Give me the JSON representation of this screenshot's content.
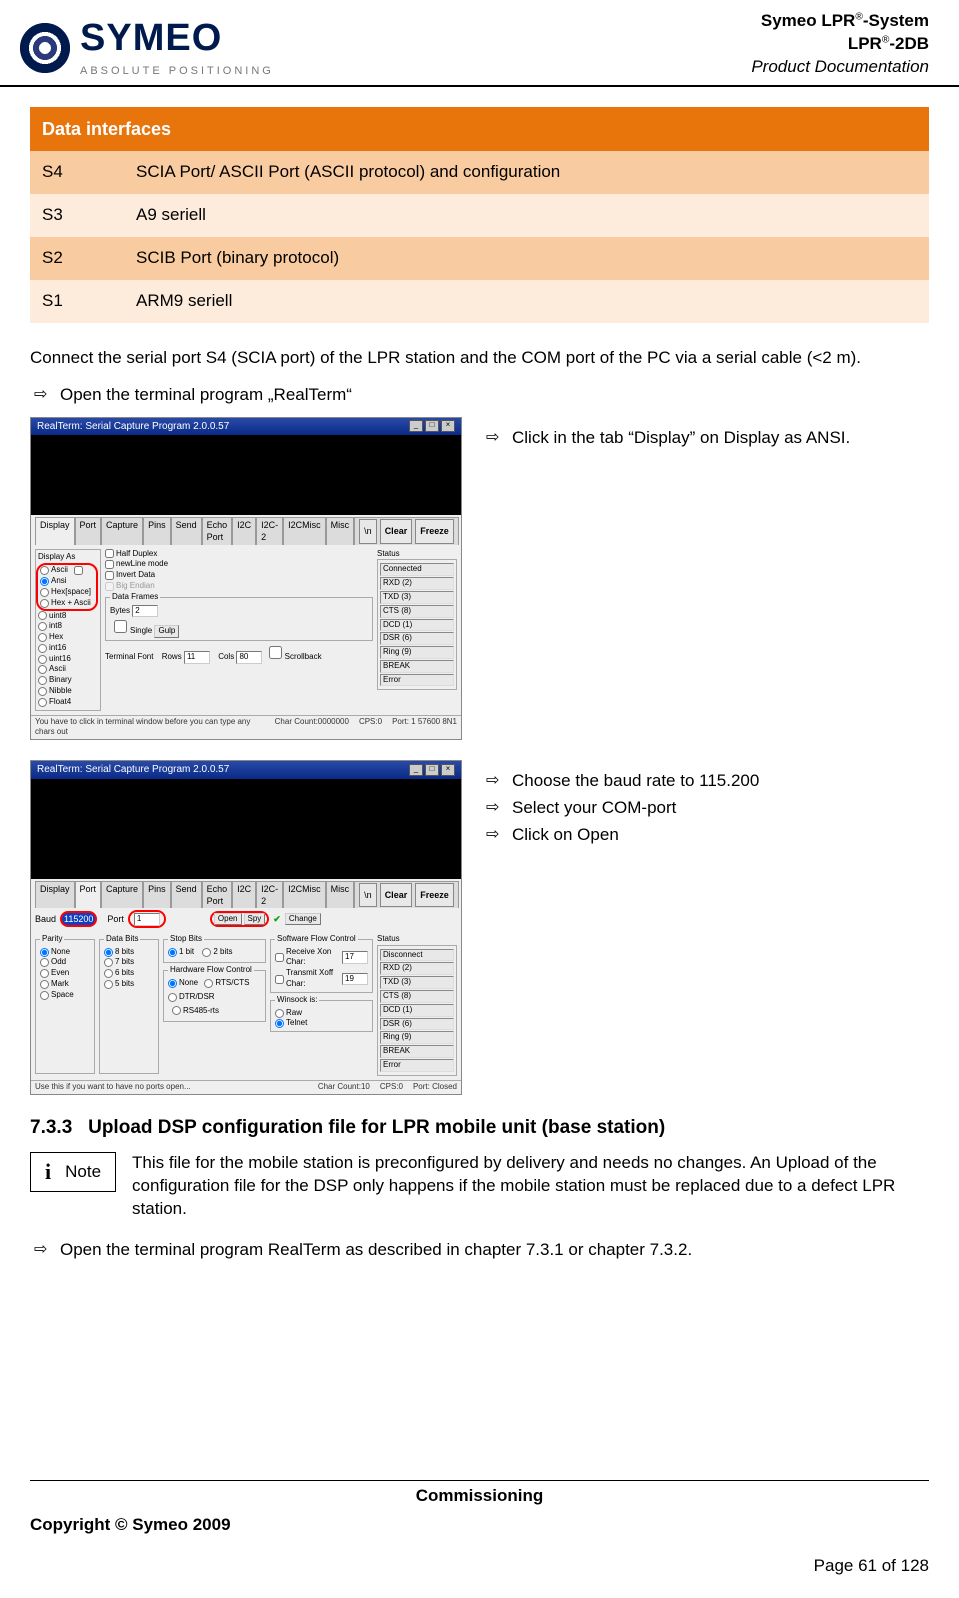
{
  "header": {
    "logo_word": "SYMEO",
    "logo_sub": "ABSOLUTE POSITIONING",
    "line1a": "Symeo LPR",
    "line1b": "-System",
    "line2a": "LPR",
    "line2b": "-2DB",
    "line3": "Product Documentation"
  },
  "table": {
    "title": "Data interfaces",
    "rows": [
      {
        "id": "S4",
        "desc": "SCIA Port/ ASCII Port (ASCII protocol) and configuration"
      },
      {
        "id": "S3",
        "desc": "A9 seriell"
      },
      {
        "id": "S2",
        "desc": "SCIB Port (binary protocol)"
      },
      {
        "id": "S1",
        "desc": "ARM9 seriell"
      }
    ]
  },
  "para_connect": "Connect the serial port S4 (SCIA port) of the LPR station and the COM port of the PC via a serial cable (<2 m).",
  "step_open": "Open the terminal program „RealTerm“",
  "shot1_caption": "Click in the tab “Display” on Display as ANSI.",
  "shot2_steps": [
    "Choose the baud rate to 115.200",
    "Select your COM-port",
    "Click on Open"
  ],
  "shot": {
    "title": "RealTerm: Serial Capture Program 2.0.0.57",
    "tabs": [
      "Display",
      "Port",
      "Capture",
      "Pins",
      "Send",
      "Echo Port",
      "I2C",
      "I2C-2",
      "I2CMisc",
      "Misc"
    ],
    "tabs_right": [
      "\\n",
      "Clear",
      "Freeze"
    ],
    "display_as_label": "Display As",
    "radios_left": [
      "Ascii",
      "Ansi",
      "Hex[space]",
      "Hex + Ascii",
      "uint8",
      "int8",
      "Hex",
      "int16",
      "uint16",
      "Ascii",
      "Binary",
      "Nibble",
      "Float4"
    ],
    "checks_mid": [
      "Half Duplex",
      "newLine mode",
      "Invert Data",
      "Big Endian"
    ],
    "data_frames": "Data Frames",
    "bytes_label": "Bytes",
    "bytes_val": "2",
    "single_label": "Single",
    "gulp_label": "Gulp",
    "rows_label": "Rows",
    "cols_label": "Cols",
    "terminal_font_label": "Terminal Font",
    "rows_val": "11",
    "cols_val": "80",
    "scrollback_label": "Scrollback",
    "status_label": "Status",
    "status_items": [
      "Connected",
      "RXD (2)",
      "TXD (3)",
      "CTS (8)",
      "DCD (1)",
      "DSR (6)",
      "Ring (9)",
      "BREAK",
      "Error"
    ],
    "statusbar1_msg": "You have to click in terminal window before you can type any chars out",
    "statusbar1_count": "Char Count:0000000",
    "statusbar1_cps": "CPS:0",
    "statusbar1_port": "Port: 1 57600 8N1",
    "baud_label": "Baud",
    "baud_val": "115200",
    "port_label": "Port",
    "port_val": "1",
    "open_label": "Open",
    "spy_label": "Spy",
    "change_label": "Change",
    "software_fc": "Software Flow Control",
    "receive_xon": "Receive Xon Char:",
    "receive_val": "17",
    "transmit_xoff": "Transmit Xoff Char:",
    "transmit_val": "19",
    "parity_label": "Parity",
    "parity_opts": [
      "None",
      "Odd",
      "Even",
      "Mark",
      "Space"
    ],
    "databits_label": "Data Bits",
    "databits_opts": [
      "8 bits",
      "7 bits",
      "6 bits",
      "5 bits"
    ],
    "stopbits_label": "Stop Bits",
    "stopbits_opts": [
      "1 bit",
      "2 bits"
    ],
    "hwfc_label": "Hardware Flow Control",
    "hwfc_opts": [
      "None",
      "RTS/CTS",
      "DTR/DSR",
      "RS485-rts"
    ],
    "winsock_label": "Winsock is:",
    "winsock_opts": [
      "Raw",
      "Telnet"
    ],
    "status2_items": [
      "Disconnect",
      "RXD (2)",
      "TXD (3)",
      "CTS (8)",
      "DCD (1)",
      "DSR (6)",
      "Ring (9)",
      "BREAK",
      "Error"
    ],
    "statusbar2_msg": "Use this if you want to have no ports open...",
    "statusbar2_count": "Char Count:10",
    "statusbar2_cps": "CPS:0",
    "statusbar2_port": "Port: Closed"
  },
  "section_num": "7.3.3",
  "section_title": "Upload DSP configuration file for LPR mobile unit (base station)",
  "note_label": "Note",
  "note_text": "This file for the mobile station is preconfigured by delivery and needs no changes. An Upload of the configuration file for the DSP only happens if the mobile station must be replaced due to a defect LPR station.",
  "step_open2": "Open the terminal program RealTerm as described in chapter 7.3.1 or chapter 7.3.2.",
  "footer": {
    "center": "Commissioning",
    "copy": "Copyright © Symeo 2009",
    "page": "Page 61 of 128"
  }
}
